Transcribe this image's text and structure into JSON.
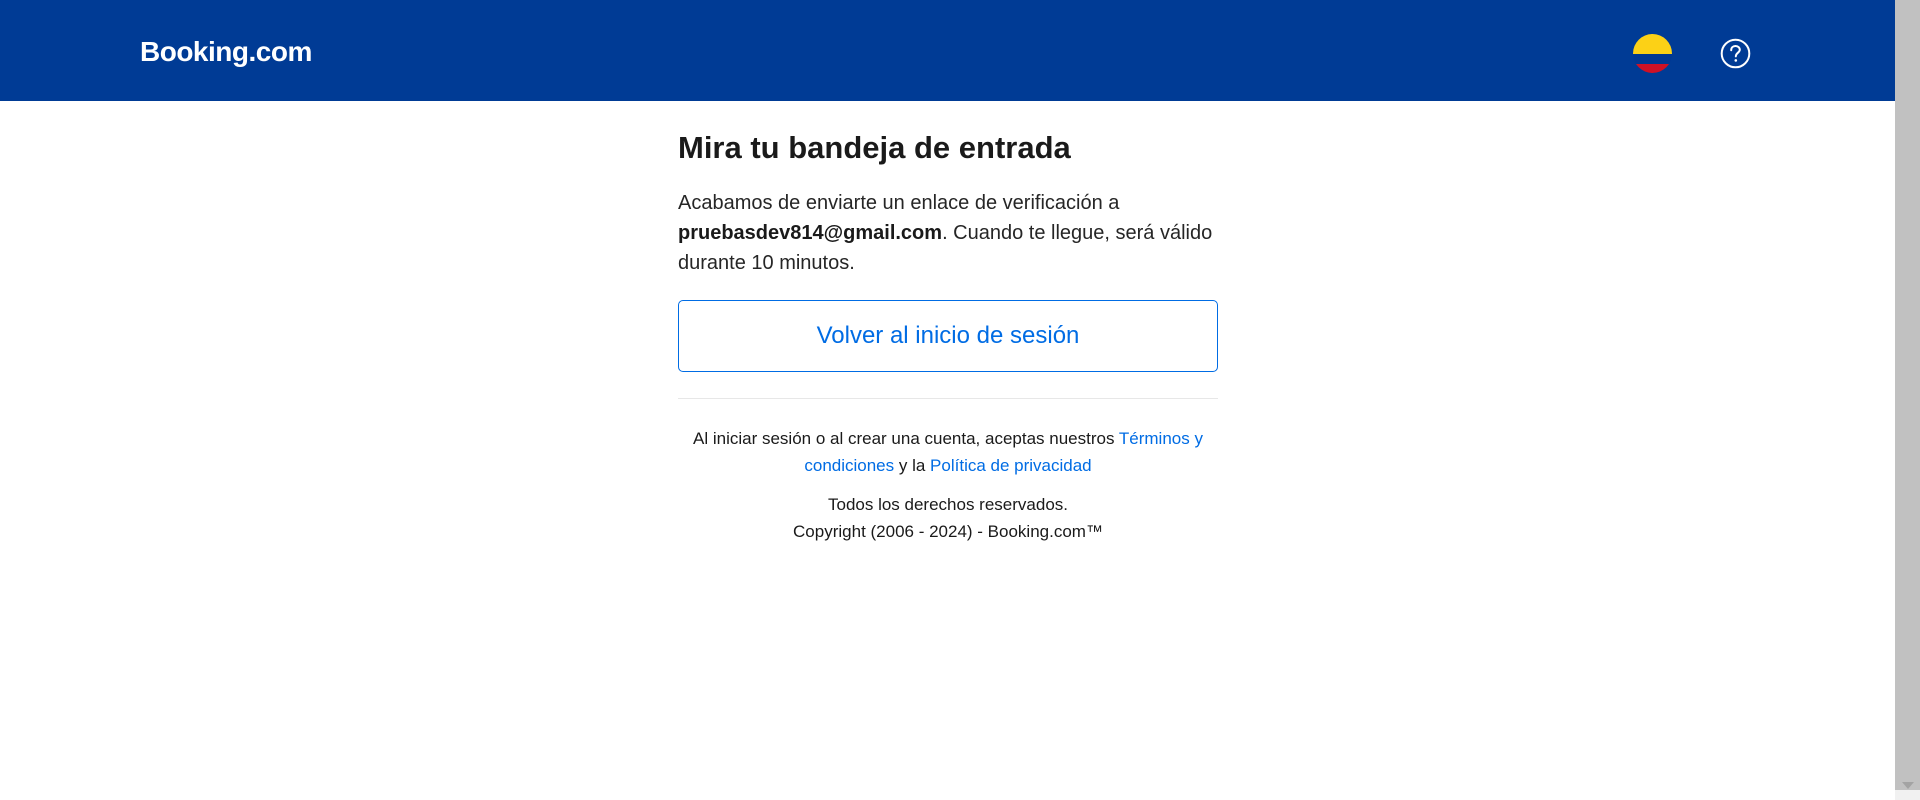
{
  "header": {
    "logo": "Booking.com",
    "flag_icon": "colombia-flag-icon",
    "help_icon": "question-circle-icon",
    "background_color": "#003b95"
  },
  "main": {
    "title": "Mira tu bandeja de entrada",
    "message_before": "Acabamos de enviarte un enlace de verificación a ",
    "email": "pruebasdev814@gmail.com",
    "message_after": ". Cuando te llegue, será válido durante 10 minutos.",
    "back_button": "Volver al inicio de sesión"
  },
  "footer": {
    "terms_prefix": "Al iniciar sesión o al crear una cuenta, aceptas nuestros ",
    "terms_link": "Términos y condiciones",
    "terms_middle": " y la ",
    "privacy_link": "Política de privacidad",
    "rights": "Todos los derechos reservados.",
    "copyright": "Copyright (2006 - 2024) - Booking.com™"
  },
  "colors": {
    "brand_blue": "#003b95",
    "link_blue": "#006ce4"
  }
}
